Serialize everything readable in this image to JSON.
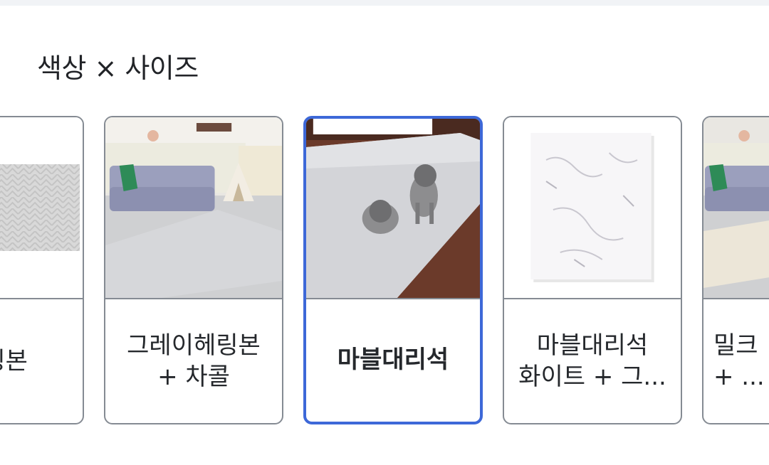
{
  "option_group": {
    "title": "색상 × 사이즈"
  },
  "options": [
    {
      "label": "헤링본",
      "selected": false,
      "thumb_icon": "gray-herringbone-mat-image"
    },
    {
      "label": "그레이헤링본\n+ 차콜",
      "selected": false,
      "thumb_icon": "living-room-mat-image"
    },
    {
      "label": "마블대리석",
      "selected": true,
      "thumb_icon": "poodles-on-mat-image"
    },
    {
      "label": "마블대리석\n화이트 + 그...",
      "selected": false,
      "thumb_icon": "white-marble-mat-image"
    },
    {
      "label": "밀크\n+ ...",
      "selected": false,
      "thumb_icon": "living-room-mat-image"
    }
  ],
  "colors": {
    "selected_border": "#3d68d8",
    "border": "#858b93",
    "text": "#25282c"
  }
}
